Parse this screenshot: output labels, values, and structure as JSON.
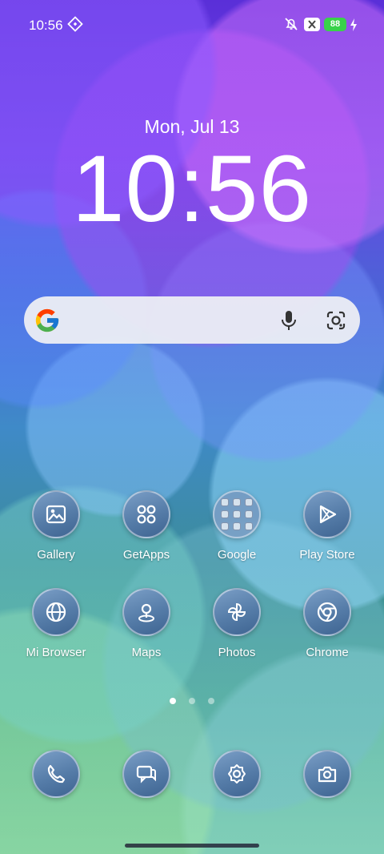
{
  "status_bar": {
    "time": "10:56",
    "battery": "88"
  },
  "lockscreen": {
    "date": "Mon, Jul 13",
    "clock": "10:56"
  },
  "apps": [
    {
      "label": "Gallery"
    },
    {
      "label": "GetApps"
    },
    {
      "label": "Google"
    },
    {
      "label": "Play Store"
    },
    {
      "label": "Mi Browser"
    },
    {
      "label": "Maps"
    },
    {
      "label": "Photos"
    },
    {
      "label": "Chrome"
    }
  ],
  "dock": [
    {
      "icon": "phone-icon"
    },
    {
      "icon": "messages-icon"
    },
    {
      "icon": "settings-icon"
    },
    {
      "icon": "camera-icon"
    }
  ],
  "pagination": {
    "pages": 3,
    "current": 1
  }
}
